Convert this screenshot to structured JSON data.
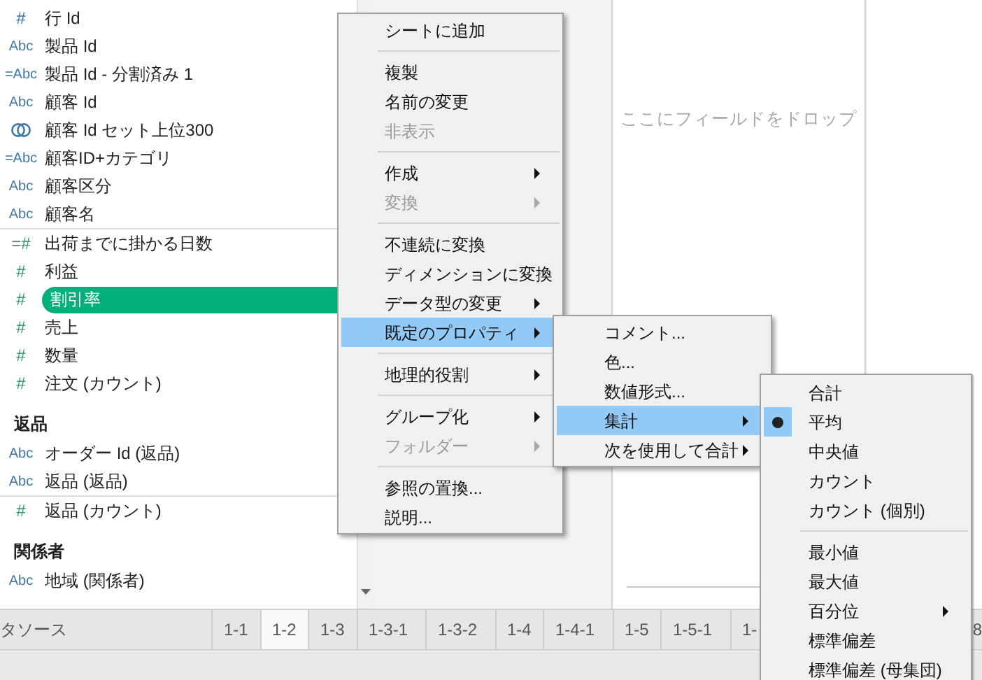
{
  "field_list": {
    "sections": [
      {
        "groups": [
          [
            {
              "kind": "dimension",
              "icon_text": "#",
              "label": "行 Id",
              "selected": false
            },
            {
              "kind": "dimension",
              "icon_text": "Abc",
              "label": "製品 Id",
              "selected": false
            },
            {
              "kind": "dimension",
              "icon_text": "=Abc",
              "label": "製品 Id - 分割済み 1",
              "selected": false
            },
            {
              "kind": "dimension",
              "icon_text": "Abc",
              "label": "顧客 Id",
              "selected": false
            },
            {
              "kind": "set",
              "label": "顧客 Id セット上位300",
              "selected": false
            },
            {
              "kind": "dimension",
              "icon_text": "=Abc",
              "label": "顧客ID+カテゴリ",
              "selected": false
            },
            {
              "kind": "dimension",
              "icon_text": "Abc",
              "label": "顧客区分",
              "selected": false
            },
            {
              "kind": "dimension",
              "icon_text": "Abc",
              "label": "顧客名",
              "selected": false
            }
          ],
          [
            {
              "kind": "measure",
              "icon_text": "=#",
              "label": "出荷までに掛かる日数",
              "selected": false
            },
            {
              "kind": "measure",
              "icon_text": "#",
              "label": "利益",
              "selected": false
            },
            {
              "kind": "measure",
              "icon_text": "#",
              "label": "割引率",
              "selected": true
            },
            {
              "kind": "measure",
              "icon_text": "#",
              "label": "売上",
              "selected": false
            },
            {
              "kind": "measure",
              "icon_text": "#",
              "label": "数量",
              "selected": false
            },
            {
              "kind": "measure",
              "icon_text": "#",
              "label": "注文 (カウント)",
              "selected": false
            }
          ]
        ]
      },
      {
        "heading": "返品",
        "groups": [
          [
            {
              "kind": "dimension",
              "icon_text": "Abc",
              "label": "オーダー Id (返品)",
              "selected": false
            },
            {
              "kind": "dimension",
              "icon_text": "Abc",
              "label": "返品 (返品)",
              "selected": false
            }
          ],
          [
            {
              "kind": "measure",
              "icon_text": "#",
              "label": "返品 (カウント)",
              "selected": false
            }
          ]
        ]
      },
      {
        "heading": "関係者",
        "groups": [
          [
            {
              "kind": "dimension",
              "icon_text": "Abc",
              "label": "地域 (関係者)",
              "selected": false
            }
          ]
        ]
      }
    ]
  },
  "canvas": {
    "placeholder": "ここにフィールドをドロップ"
  },
  "sheet_tabs": {
    "data_source": "タソース",
    "tabs": [
      {
        "label": "1-1",
        "selected": false
      },
      {
        "label": "1-2",
        "selected": true
      },
      {
        "label": "1-3",
        "selected": false
      },
      {
        "label": "1-3-1",
        "selected": false
      },
      {
        "label": "1-3-2",
        "selected": false
      },
      {
        "label": "1-4",
        "selected": false
      },
      {
        "label": "1-4-1",
        "selected": false
      },
      {
        "label": "1-5",
        "selected": false
      },
      {
        "label": "1-5-1",
        "selected": false
      },
      {
        "label": "1-",
        "selected": false
      }
    ],
    "edge_tab": "8"
  },
  "context_menu": {
    "groups": [
      [
        {
          "label": "シートに追加",
          "disabled": false,
          "submenu": false,
          "highlighted": false
        }
      ],
      [
        {
          "label": "複製",
          "disabled": false,
          "submenu": false,
          "highlighted": false
        },
        {
          "label": "名前の変更",
          "disabled": false,
          "submenu": false,
          "highlighted": false
        },
        {
          "label": "非表示",
          "disabled": true,
          "submenu": false,
          "highlighted": false
        }
      ],
      [
        {
          "label": "作成",
          "disabled": false,
          "submenu": true,
          "highlighted": false
        },
        {
          "label": "変換",
          "disabled": true,
          "submenu": true,
          "highlighted": false
        }
      ],
      [
        {
          "label": "不連続に変換",
          "disabled": false,
          "submenu": false,
          "highlighted": false
        },
        {
          "label": "ディメンションに変換",
          "disabled": false,
          "submenu": false,
          "highlighted": false
        },
        {
          "label": "データ型の変更",
          "disabled": false,
          "submenu": true,
          "highlighted": false
        },
        {
          "label": "既定のプロパティ",
          "disabled": false,
          "submenu": true,
          "highlighted": true
        }
      ],
      [
        {
          "label": "地理的役割",
          "disabled": false,
          "submenu": true,
          "highlighted": false
        }
      ],
      [
        {
          "label": "グループ化",
          "disabled": false,
          "submenu": true,
          "highlighted": false
        },
        {
          "label": "フォルダー",
          "disabled": true,
          "submenu": true,
          "highlighted": false
        }
      ],
      [
        {
          "label": "参照の置換...",
          "disabled": false,
          "submenu": false,
          "highlighted": false
        },
        {
          "label": "説明...",
          "disabled": false,
          "submenu": false,
          "highlighted": false
        }
      ]
    ]
  },
  "properties_submenu": {
    "groups": [
      [
        {
          "label": "コメント...",
          "disabled": false,
          "submenu": false,
          "highlighted": false
        },
        {
          "label": "色...",
          "disabled": false,
          "submenu": false,
          "highlighted": false
        },
        {
          "label": "数値形式...",
          "disabled": false,
          "submenu": false,
          "highlighted": false
        },
        {
          "label": "集計",
          "disabled": false,
          "submenu": true,
          "highlighted": true
        },
        {
          "label": "次を使用して合計",
          "disabled": false,
          "submenu": true,
          "highlighted": false
        }
      ]
    ]
  },
  "aggregation_submenu": {
    "groups": [
      [
        {
          "label": "合計",
          "checked": false,
          "submenu": false
        },
        {
          "label": "平均",
          "checked": true,
          "submenu": false
        },
        {
          "label": "中央値",
          "checked": false,
          "submenu": false
        },
        {
          "label": "カウント",
          "checked": false,
          "submenu": false
        },
        {
          "label": "カウント (個別)",
          "checked": false,
          "submenu": false
        }
      ],
      [
        {
          "label": "最小値",
          "checked": false,
          "submenu": false
        },
        {
          "label": "最大値",
          "checked": false,
          "submenu": false
        },
        {
          "label": "百分位",
          "checked": false,
          "submenu": true
        },
        {
          "label": "標準偏差",
          "checked": false,
          "submenu": false
        },
        {
          "label": "標準偏差 (母集団)",
          "checked": false,
          "submenu": false
        }
      ]
    ]
  }
}
